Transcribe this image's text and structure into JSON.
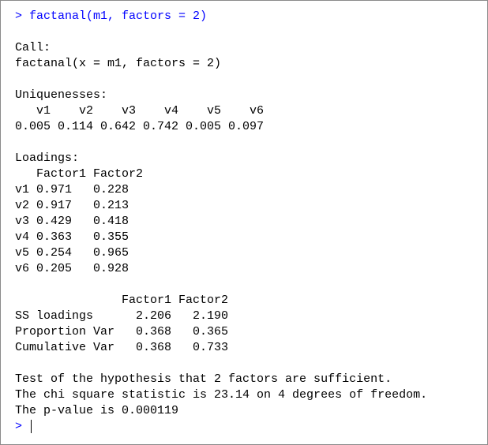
{
  "console": {
    "command_line": "> factanal(m1, factors = 2)",
    "lines": [
      "Call:",
      "factanal(x = m1, factors = 2)",
      "Uniquenesses:",
      "   v1    v2    v3    v4    v5    v6",
      "0.005 0.114 0.642 0.742 0.005 0.097",
      "Loadings:",
      "   Factor1 Factor2",
      "v1 0.971   0.228",
      "v2 0.917   0.213",
      "v3 0.429   0.418",
      "v4 0.363   0.355",
      "v5 0.254   0.965",
      "v6 0.205   0.928",
      "               Factor1 Factor2",
      "SS loadings      2.206   2.190",
      "Proportion Var   0.368   0.365",
      "Cumulative Var   0.368   0.733",
      "Test of the hypothesis that 2 factors are sufficient.",
      "The chi square statistic is 23.14 on 4 degrees of freedom.",
      "The p-value is 0.000119"
    ],
    "prompt": ">"
  }
}
